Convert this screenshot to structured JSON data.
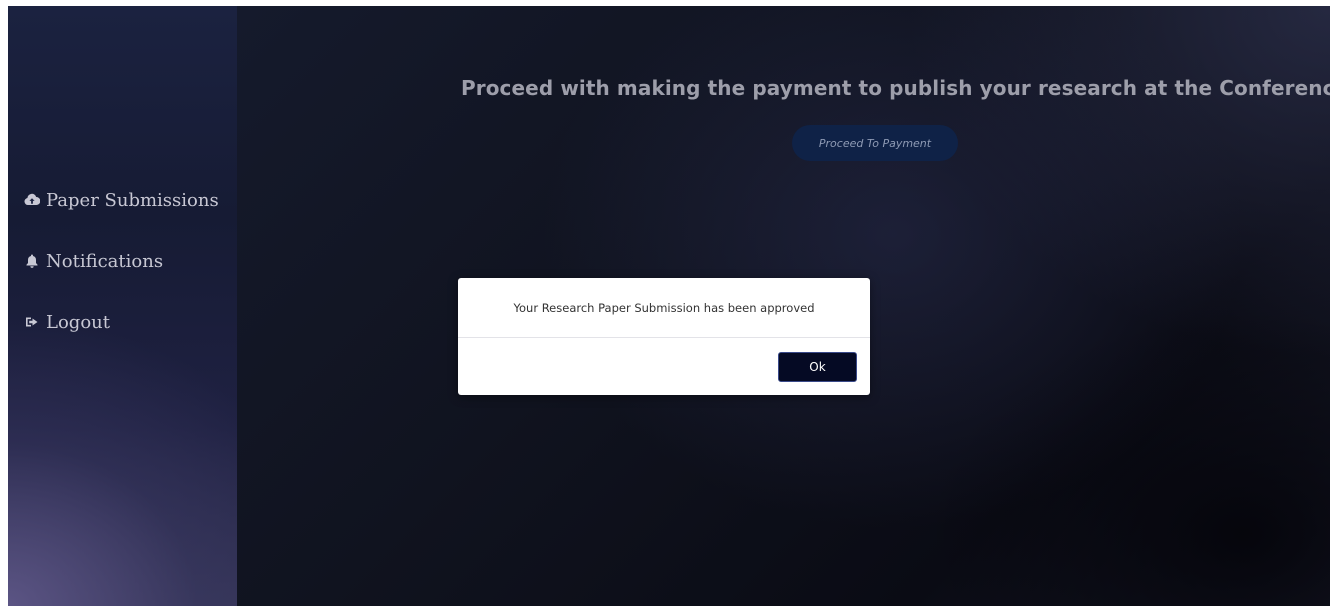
{
  "sidebar": {
    "items": [
      {
        "label": "Paper Submissions",
        "icon": "cloud-upload-icon"
      },
      {
        "label": "Notifications",
        "icon": "bell-icon"
      },
      {
        "label": "Logout",
        "icon": "sign-out-icon"
      }
    ]
  },
  "main": {
    "headline": "Proceed with making the payment to publish your research at the Conference",
    "payment_button_label": "Proceed To Payment"
  },
  "modal": {
    "message": "Your Research Paper Submission has been approved",
    "ok_label": "Ok"
  },
  "colors": {
    "sidebar_bg": "#1b2240",
    "main_bg": "#10131f",
    "payment_button_bg": "#0f2247",
    "ok_button_bg": "#050a24",
    "headline_text": "#9d9eaa"
  }
}
